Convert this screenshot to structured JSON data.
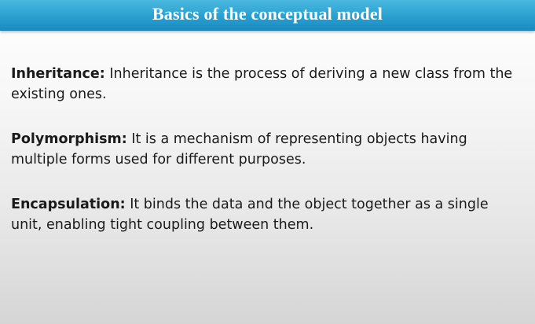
{
  "slide": {
    "title": "Basics of the conceptual model"
  },
  "items": [
    {
      "term": "Inheritance:",
      "description": " Inheritance is the process of deriving a new class from the existing ones."
    },
    {
      "term": "Polymorphism:",
      "description": " It is a mechanism of representing objects having multiple forms used for different purposes."
    },
    {
      "term": "Encapsulation:",
      "description": " It binds the data and the object together as a single unit, enabling tight coupling between them."
    }
  ],
  "colors": {
    "title_bar": "#2aa0d0",
    "title_text": "#ffffff",
    "body_text": "#1a1a1a"
  }
}
